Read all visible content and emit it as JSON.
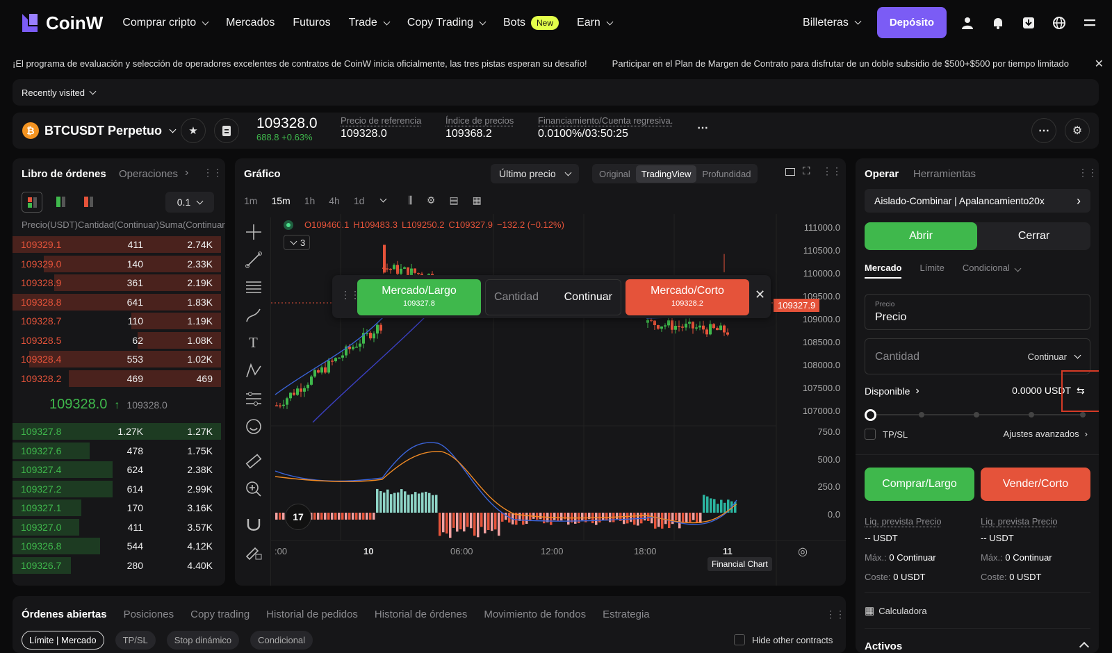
{
  "nav": {
    "brand": "CoinW",
    "items": [
      {
        "label": "Comprar cripto",
        "dropdown": true
      },
      {
        "label": "Mercados",
        "dropdown": false
      },
      {
        "label": "Futuros",
        "dropdown": false
      },
      {
        "label": "Trade",
        "dropdown": true
      },
      {
        "label": "Copy Trading",
        "dropdown": true
      },
      {
        "label": "Bots",
        "badge": "New"
      },
      {
        "label": "Earn",
        "dropdown": true
      }
    ],
    "wallets": "Billeteras",
    "deposit": "Depósito"
  },
  "ticker": {
    "msg1": "¡El programa de evaluación y selección de operadores excelentes de contratos de CoinW inicia oficialmente, las tres pistas esperan su desafío!",
    "msg2": "Participar en el Plan de Margen de Contrato para disfrutar de un doble subsidio de $500+$500 por tiempo limitado"
  },
  "recently": "Recently visited",
  "symbol": {
    "name": "BTCUSDT Perpetuo",
    "price": "109328.0",
    "change": "688.8 +0.63%",
    "ref_label": "Precio de referencia",
    "ref_value": "109328.0",
    "idx_label": "Índice de precios",
    "idx_value": "109368.2",
    "fund_label": "Financiamiento/Cuenta regresiva.",
    "fund_value": "0.0100%/03:50:25"
  },
  "orderbook": {
    "title": "Libro de órdenes",
    "tab2": "Operaciones",
    "precision": "0.1",
    "col_price": "Precio(USDT)",
    "col_qty": "Cantidad(Continuar)",
    "col_sum": "Suma(Continuar)",
    "asks": [
      {
        "p": "109329.1",
        "q": "411",
        "s": "2.74K",
        "depth": 1.0
      },
      {
        "p": "109329.0",
        "q": "140",
        "s": "2.33K",
        "depth": 0.85
      },
      {
        "p": "109328.9",
        "q": "361",
        "s": "2.19K",
        "depth": 0.8
      },
      {
        "p": "109328.8",
        "q": "641",
        "s": "1.83K",
        "depth": 1.0
      },
      {
        "p": "109328.7",
        "q": "110",
        "s": "1.19K",
        "depth": 0.43
      },
      {
        "p": "109328.5",
        "q": "62",
        "s": "1.08K",
        "depth": 0.4
      },
      {
        "p": "109328.4",
        "q": "553",
        "s": "1.02K",
        "depth": 0.92
      },
      {
        "p": "109328.2",
        "q": "469",
        "s": "469",
        "depth": 0.73
      }
    ],
    "mid": "109328.0",
    "mid_ref": "109328.0",
    "bids": [
      {
        "p": "109327.8",
        "q": "1.27K",
        "s": "1.27K",
        "depth": 1.0
      },
      {
        "p": "109327.6",
        "q": "478",
        "s": "1.75K",
        "depth": 0.37
      },
      {
        "p": "109327.4",
        "q": "624",
        "s": "2.38K",
        "depth": 0.48
      },
      {
        "p": "109327.2",
        "q": "614",
        "s": "2.99K",
        "depth": 0.48
      },
      {
        "p": "109327.1",
        "q": "170",
        "s": "3.16K",
        "depth": 0.33
      },
      {
        "p": "109327.0",
        "q": "411",
        "s": "3.57K",
        "depth": 0.32
      },
      {
        "p": "109326.8",
        "q": "544",
        "s": "4.12K",
        "depth": 0.42
      },
      {
        "p": "109326.7",
        "q": "280",
        "s": "4.40K",
        "depth": 0.28
      }
    ]
  },
  "chart": {
    "title": "Gráfico",
    "price_type": "Último precio",
    "views": [
      "Original",
      "TradingView",
      "Profundidad"
    ],
    "intervals": [
      "1m",
      "15m",
      "1h",
      "4h",
      "1d"
    ],
    "ohlc": {
      "o": "O109460.1",
      "h": "H109483.3",
      "l": "L109250.2",
      "c": "C109327.9",
      "chg": "−132.2 (−0.12%)"
    },
    "indicator_count": "3",
    "buy_label": "Mercado/Largo",
    "buy_price": "109327.8",
    "qty_label": "Cantidad",
    "qty_unit": "Continuar",
    "sell_label": "Mercado/Corto",
    "sell_price": "109328.2",
    "last_price_tag": "109327.9",
    "price_axis": [
      "111000.0",
      "110500.0",
      "110000.0",
      "109500.0",
      "109000.0",
      "108500.0",
      "108000.0",
      "107500.0",
      "107000.0"
    ],
    "macd_axis": [
      "750.0",
      "500.0",
      "250.0",
      "0.0"
    ],
    "time_axis": [
      ":00",
      "10",
      "06:00",
      "12:00",
      "18:00",
      "11"
    ],
    "watermark": "Financial Chart"
  },
  "trade": {
    "tab1": "Operar",
    "tab2": "Herramientas",
    "mode": "Aislado-Combinar | Apalancamiento20x",
    "open": "Abrir",
    "close": "Cerrar",
    "order_types": [
      "Mercado",
      "Límite",
      "Condicional"
    ],
    "price_small": "Precio",
    "price_value": "Precio",
    "qty_placeholder": "Cantidad",
    "qty_unit": "Continuar",
    "available_label": "Disponible",
    "available_value": "0.0000 USDT",
    "tpsl": "TP/SL",
    "advanced": "Ajustes avanzados",
    "buy_btn": "Comprar/Largo",
    "sell_btn": "Vender/Corto",
    "liq_label": "Liq. prevista Precio",
    "liq_value": "-- USDT",
    "max_label": "Máx.:",
    "max_value": "0 Continuar",
    "cost_label": "Coste:",
    "cost_value": "0 USDT",
    "calculator": "Calculadora",
    "assets": "Activos"
  },
  "bottom": {
    "tabs": [
      "Órdenes abiertas",
      "Posiciones",
      "Copy trading",
      "Historial de pedidos",
      "Historial de órdenes",
      "Movimiento de fondos",
      "Estrategia"
    ],
    "filters": [
      "Límite | Mercado",
      "TP/SL",
      "Stop dinámico",
      "Condicional"
    ],
    "hide_other": "Hide other contracts"
  },
  "colors": {
    "green": "#3fb84c",
    "red": "#e5533a",
    "accent": "#7b5cf5"
  }
}
